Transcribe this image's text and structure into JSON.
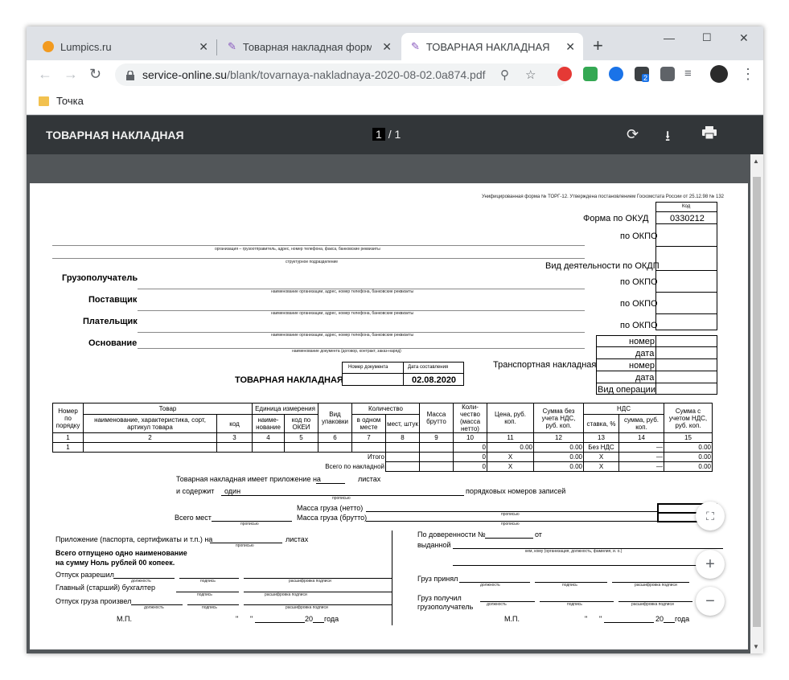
{
  "browser": {
    "tabs": [
      {
        "title": "Lumpics.ru",
        "close": "✕"
      },
      {
        "title": "Товарная накладная форма N",
        "close": "✕"
      },
      {
        "title": "ТОВАРНАЯ НАКЛАДНАЯ",
        "close": "✕"
      }
    ],
    "new_tab": "+",
    "window_controls": {
      "minimize": "—",
      "maximize": "☐",
      "close": "✕"
    },
    "url_host": "service-online.su",
    "url_path": "/blank/tovarnaya-nakladnaya-2020-08-02.0a874.pdf",
    "extension_badge": "2",
    "bookmark": "Точка"
  },
  "pdf": {
    "title": "ТОВАРНАЯ НАКЛАДНАЯ",
    "page_current": "1",
    "page_sep": "/",
    "page_total": "1"
  },
  "doc": {
    "unified_form": "Унифицированная форма № ТОРГ-12. Утверждена постановлением Госкомстата России от 25.12.98 № 132",
    "kod": "Код",
    "okud_label": "Форма по ОКУД",
    "okud_value": "0330212",
    "okpo_label": "по ОКПО",
    "org_caption": "организация – грузоотправитель, адрес, номер телефона, факса, банковские реквизиты",
    "struct_caption": "структурное подразделение",
    "okdp_label": "Вид деятельности по ОКДП",
    "consignee": "Грузополучатель",
    "supplier": "Поставщик",
    "payer": "Плательщик",
    "basis": "Основание",
    "org_req_caption": "наименование организации, адрес, номер телефона, банковские реквизиты",
    "basis_caption": "наименование документа (договор, контракт, заказ-наряд)",
    "nomer": "номер",
    "data": "дата",
    "transport": "Транспортная накладная",
    "operation": "Вид операции",
    "doc_number_label": "Номер документа",
    "doc_date_label": "Дата составления",
    "doc_title": "ТОВАРНАЯ НАКЛАДНАЯ",
    "doc_date": "02.08.2020"
  },
  "table": {
    "h_num": "Номер по порядку",
    "h_goods": "Товар",
    "h_goods_name": "наименование, характеристика, сорт, артикул товара",
    "h_goods_code": "код",
    "h_unit": "Единица измерения",
    "h_unit_name": "наиме-нование",
    "h_unit_okei": "код по ОКЕИ",
    "h_pack": "Вид упаковки",
    "h_qty": "Количество",
    "h_qty_one": "в одном месте",
    "h_qty_places": "мест, штук",
    "h_gross": "Масса брутто",
    "h_count": "Коли-чество (масса нетто)",
    "h_price": "Цена, руб. коп.",
    "h_sum_novat": "Сумма без учета НДС, руб. коп.",
    "h_vat": "НДС",
    "h_vat_rate": "ставка, %",
    "h_vat_sum": "сумма, руб. коп.",
    "h_sum_vat": "Сумма с учетом НДС, руб. коп.",
    "col_nums": [
      "1",
      "2",
      "3",
      "4",
      "5",
      "6",
      "7",
      "8",
      "9",
      "10",
      "11",
      "12",
      "13",
      "14",
      "15"
    ],
    "row": {
      "num": "1",
      "count": "0",
      "price": "0.00",
      "sum_novat": "0.00",
      "vat_rate": "Без НДС",
      "vat_sum": "—",
      "sum_vat": "0.00"
    },
    "itogo_label": "Итого",
    "itogo": {
      "count": "0",
      "price": "X",
      "sum_novat": "0.00",
      "vat_rate": "X",
      "vat_sum": "—",
      "sum_vat": "0.00"
    },
    "total_label": "Всего по накладной",
    "total": {
      "count": "0",
      "price": "X",
      "sum_novat": "0.00",
      "vat_rate": "X",
      "vat_sum": "—",
      "sum_vat": "0.00"
    }
  },
  "footer": {
    "appendix": "Товарная накладная имеет приложение на",
    "sheets": "листах",
    "contains": "и содержит",
    "one": "один",
    "records": "порядковых номеров записей",
    "propis": "прописью",
    "net": "Масса груза (нетто)",
    "gross": "Масса груза (брутто)",
    "total_places": "Всего мест",
    "attachment": "Приложение (паспорта, сертификаты и т.п.) на",
    "released_total": "Всего отпущено одно наименование",
    "released_sum": "на сумму Ноль рублей 00 копеек.",
    "allowed": "Отпуск разрешил",
    "chief": "Главный (старший) бухгалтер",
    "produced": "Отпуск груза произвел",
    "dolzhnost": "должность",
    "podpis": "подпись",
    "rasshifrovka": "расшифровка подписи",
    "mp": "М.П.",
    "quote": "\"",
    "year": "20",
    "goda": "года",
    "poa": "По доверенности №",
    "ot": "от",
    "issued": "выданной",
    "issued_caption": "кем, кому (организация, должность, фамилия, и. о.)",
    "cargo_accepted": "Груз принял",
    "cargo_received": "Груз получил",
    "consignee2": "грузополучатель"
  },
  "zoom": {
    "fit": "⛶",
    "plus": "+",
    "minus": "−"
  }
}
